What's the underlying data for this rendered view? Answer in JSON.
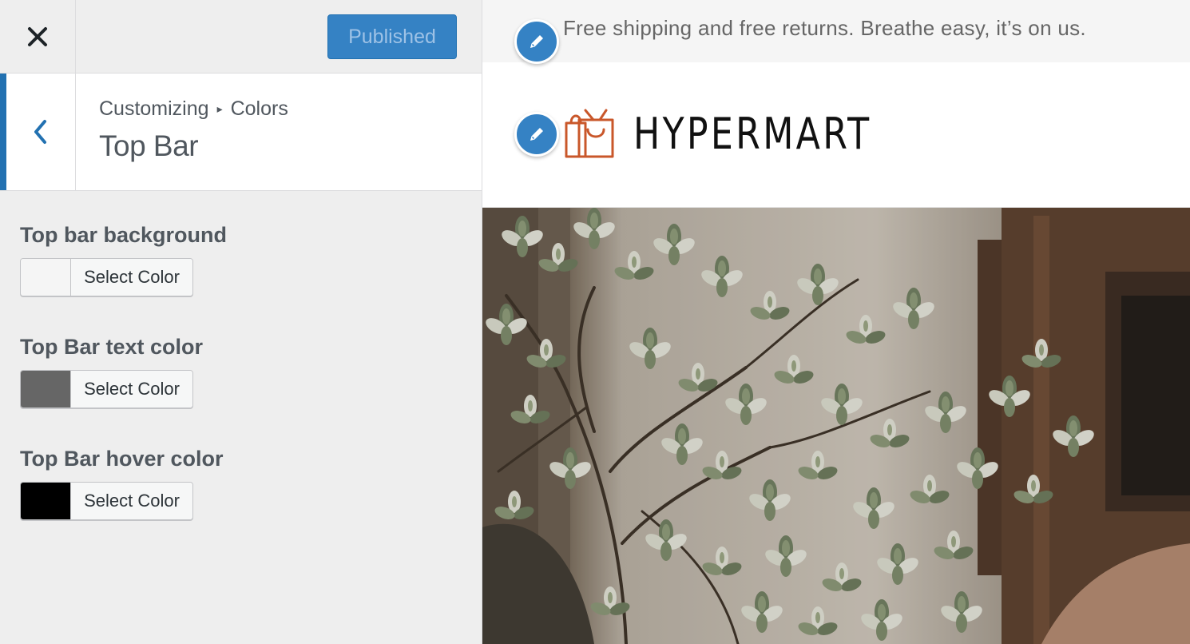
{
  "sidebar": {
    "publish_label": "Published",
    "breadcrumb": {
      "parent": "Customizing",
      "current": "Colors"
    },
    "panel_title": "Top Bar",
    "controls": [
      {
        "label": "Top bar background",
        "button_label": "Select Color",
        "color": "#f5f5f5"
      },
      {
        "label": "Top Bar text color",
        "button_label": "Select Color",
        "color": "#666666"
      },
      {
        "label": "Top Bar hover color",
        "button_label": "Select Color",
        "color": "#000000"
      }
    ]
  },
  "preview": {
    "topbar_text": "Free shipping and free returns. Breathe easy, it’s on us.",
    "logo_text": "HYPERMART"
  },
  "colors": {
    "accent": "#3582c4",
    "publish_text": "#9ec2e6",
    "logo_icon": "#c9572a"
  },
  "icons": {
    "close": "close-icon",
    "back": "chevron-left-icon",
    "edit": "pencil-icon",
    "logo": "shopping-bags-icon"
  }
}
